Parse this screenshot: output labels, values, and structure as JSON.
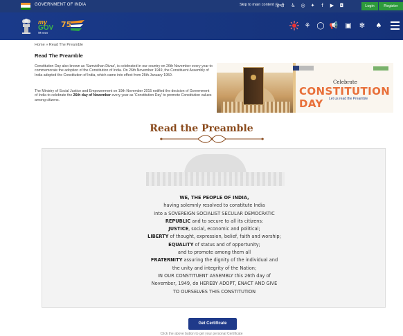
{
  "topbar": {
    "gov_label": "GOVERNMENT OF INDIA",
    "skip": "Skip to main content",
    "hindi": "हिन्दी",
    "login": "Login",
    "register": "Register",
    "icons": [
      "accessibility-icon",
      "settings-icon",
      "twitter-icon",
      "facebook-icon",
      "youtube-icon",
      "instagram-icon"
    ]
  },
  "header": {
    "logo_my": "my",
    "logo_gov": "GOV",
    "logo_sub": "मेरी सरकार",
    "icons": [
      "sun-icon",
      "lotus-icon",
      "chat-icon",
      "megaphone-icon",
      "dashboard-icon",
      "flower-icon",
      "bell-icon",
      "menu-icon"
    ]
  },
  "breadcrumb": "Home  »  Read The Preamble",
  "page_title": "Read The Preamble",
  "intro": {
    "p1": "Constitution Day also known as 'Samvidhan Divas', is celebrated in our country on 26th November every year to commemorate the adoption of the Constitution of India. On 26th November 1949, the Constituent Assembly of India adopted the Constitution of India, which came into effect from 26th January 1950.",
    "p2_a": "The Ministry of Social Justice and Empowerment on 19th November 2015 notified the decision of Government of India to celebrate the ",
    "p2_b": "26th day of November",
    "p2_c": " every year as 'Constitution Day' to promote Constitution values among citizens."
  },
  "banner": {
    "celebrate": "Celebrate",
    "title": "CONSTITUTION DAY",
    "tagline": "Let us read the Preamble"
  },
  "section_title": "Read the Preamble",
  "preamble": {
    "l1": "WE, THE PEOPLE OF INDIA,",
    "l2": "having solemnly resolved to constitute India",
    "l3": "into a SOVEREIGN SOCIALIST SECULAR DEMOCRATIC",
    "l4a": "REPUBLIC",
    "l4b": " and to secure to all its citizens:",
    "l5a": "JUSTICE",
    "l5b": ", social, economic and political;",
    "l6a": "LIBERTY",
    "l6b": " of thought, expression, belief, faith and worship;",
    "l7a": "EQUALITY",
    "l7b": " of status and of opportunity;",
    "l8": "and to promote among them all",
    "l9a": "FRATERNITY",
    "l9b": " assuring the dignity of the individual and",
    "l10": "the unity and integrity of the Nation;",
    "l11": "IN OUR CONSTITUENT ASSEMBLY this 26th day of",
    "l12": "November, 1949, do HEREBY ADOPT, ENACT AND GIVE",
    "l13": "TO OURSELVES THIS CONSTITUTION"
  },
  "cert_button": "Get Certificate",
  "caption": "Click the above button to get your personal Certificate"
}
